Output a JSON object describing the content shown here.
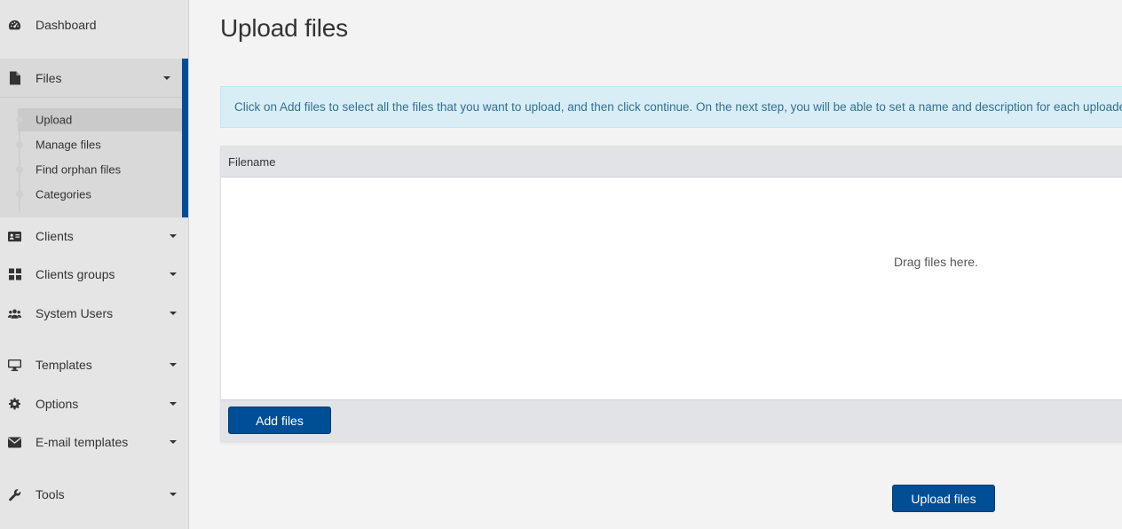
{
  "sidebar": {
    "dashboard": {
      "label": "Dashboard",
      "icon": "dashboard-icon"
    },
    "files": {
      "label": "Files",
      "icon": "file-icon",
      "subitems": [
        "Upload",
        "Manage files",
        "Find orphan files",
        "Categories"
      ],
      "active_subitem": "Upload"
    },
    "items": [
      {
        "label": "Clients",
        "icon": "address-card-icon"
      },
      {
        "label": "Clients groups",
        "icon": "th-large-icon"
      },
      {
        "label": "System Users",
        "icon": "users-icon"
      },
      {
        "label": "Templates",
        "icon": "desktop-icon"
      },
      {
        "label": "Options",
        "icon": "gear-icon"
      },
      {
        "label": "E-mail templates",
        "icon": "envelope-icon"
      },
      {
        "label": "Tools",
        "icon": "wrench-icon"
      }
    ]
  },
  "main": {
    "title": "Upload files",
    "info": "Click on Add files to select all the files that you want to upload, and then click continue. On the next step, you will be able to set a name and description for each uploaded file.",
    "uploader": {
      "column_header": "Filename",
      "drop_text": "Drag files here.",
      "add_button": "Add files"
    },
    "upload_button": "Upload files"
  },
  "colors": {
    "accent": "#004e95",
    "sidebar_bg": "#e5e5e5",
    "info_bg": "#d9edf7",
    "info_text": "#31708f"
  }
}
